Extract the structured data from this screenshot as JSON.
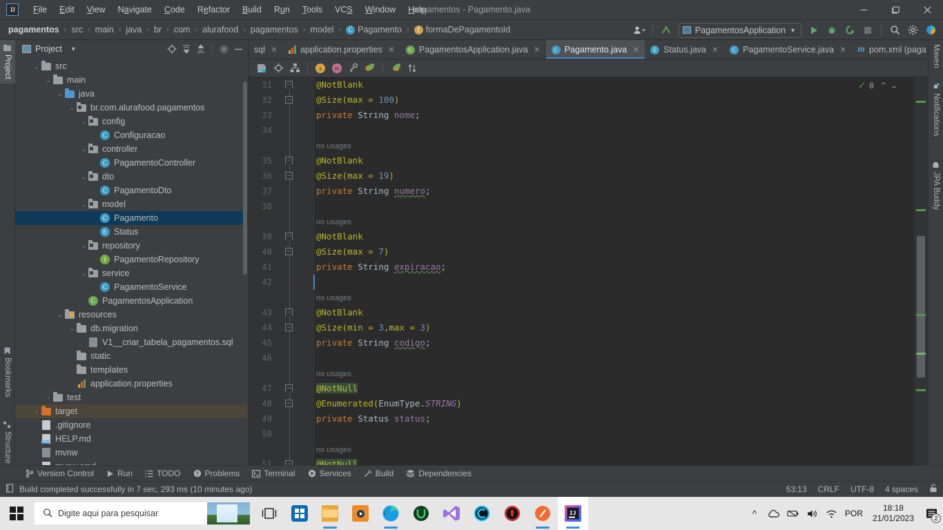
{
  "window": {
    "title": "pagamentos - Pagamento.java",
    "minimize": "—",
    "maximize": "❐",
    "close": "✕"
  },
  "menu": {
    "items": [
      {
        "label": "File"
      },
      {
        "label": "Edit"
      },
      {
        "label": "View"
      },
      {
        "label": "Navigate"
      },
      {
        "label": "Code"
      },
      {
        "label": "Refactor"
      },
      {
        "label": "Build"
      },
      {
        "label": "Run"
      },
      {
        "label": "Tools"
      },
      {
        "label": "VCS"
      },
      {
        "label": "Window"
      },
      {
        "label": "Help"
      }
    ]
  },
  "breadcrumbs": {
    "items": [
      {
        "label": "pagamentos",
        "icon": "none"
      },
      {
        "label": "src",
        "icon": "none"
      },
      {
        "label": "main",
        "icon": "none"
      },
      {
        "label": "java",
        "icon": "none"
      },
      {
        "label": "br",
        "icon": "none"
      },
      {
        "label": "com",
        "icon": "none"
      },
      {
        "label": "alurafood",
        "icon": "none"
      },
      {
        "label": "pagamentos",
        "icon": "none"
      },
      {
        "label": "model",
        "icon": "none"
      },
      {
        "label": "Pagamento",
        "icon": "class-badge"
      },
      {
        "label": "formaDePagamentoId",
        "icon": "field-badge"
      }
    ],
    "separator": "›"
  },
  "toolbar": {
    "account_icon": "user-account-icon",
    "update_icon": "vcs-update-icon",
    "run_config": "PagamentosApplication",
    "run_config_dropdown": "▾",
    "run_icon": "run-icon",
    "debug_icon": "debug-icon",
    "run_coverage_icon": "run-with-coverage-icon",
    "stop_icon": "stop-icon",
    "search_icon": "search-everywhere-icon",
    "settings_icon": "settings-gear-icon",
    "ai_icon": "ai-assistant-icon"
  },
  "left_strip": {
    "tabs": [
      {
        "label": "Project",
        "active": true,
        "icon": "project-folder-icon"
      },
      {
        "label": "Bookmarks",
        "active": false,
        "icon": "bookmark-icon"
      },
      {
        "label": "Structure",
        "active": false,
        "icon": "structure-icon"
      }
    ]
  },
  "right_strip": {
    "tabs": [
      {
        "label": "Maven",
        "icon": "maven-icon"
      },
      {
        "label": "Notifications",
        "icon": "notifications-bell-icon"
      },
      {
        "label": "JPA Buddy",
        "icon": "jpa-buddy-icon"
      }
    ]
  },
  "project_panel": {
    "title": "Project",
    "dropdown": "▾",
    "actions": [
      {
        "name": "select-opened-file",
        "glyph": "⊕"
      },
      {
        "name": "expand-all",
        "glyph": "⇟"
      },
      {
        "name": "collapse-all",
        "glyph": "⇞"
      },
      {
        "name": "settings",
        "glyph": "⚙"
      },
      {
        "name": "hide",
        "glyph": "—"
      }
    ],
    "tree": [
      {
        "label": "src",
        "indent": 1,
        "arrow": "down",
        "icon": "folder",
        "state": "normal"
      },
      {
        "label": "main",
        "indent": 2,
        "arrow": "down",
        "icon": "folder",
        "state": "normal"
      },
      {
        "label": "java",
        "indent": 3,
        "arrow": "down",
        "icon": "folder-blue",
        "state": "normal"
      },
      {
        "label": "br.com.alurafood.pagamentos",
        "indent": 4,
        "arrow": "down",
        "icon": "package",
        "state": "normal"
      },
      {
        "label": "config",
        "indent": 5,
        "arrow": "down",
        "icon": "package",
        "state": "normal"
      },
      {
        "label": "Configuracao",
        "indent": 6,
        "arrow": "none",
        "icon": "class",
        "state": "normal"
      },
      {
        "label": "controller",
        "indent": 5,
        "arrow": "down",
        "icon": "package",
        "state": "normal"
      },
      {
        "label": "PagamentoController",
        "indent": 6,
        "arrow": "none",
        "icon": "class",
        "state": "normal"
      },
      {
        "label": "dto",
        "indent": 5,
        "arrow": "down",
        "icon": "package",
        "state": "normal"
      },
      {
        "label": "PagamentoDto",
        "indent": 6,
        "arrow": "none",
        "icon": "class",
        "state": "normal"
      },
      {
        "label": "model",
        "indent": 5,
        "arrow": "down",
        "icon": "package",
        "state": "normal"
      },
      {
        "label": "Pagamento",
        "indent": 6,
        "arrow": "none",
        "icon": "class",
        "state": "selected"
      },
      {
        "label": "Status",
        "indent": 6,
        "arrow": "none",
        "icon": "enum",
        "state": "normal"
      },
      {
        "label": "repository",
        "indent": 5,
        "arrow": "down",
        "icon": "package",
        "state": "normal"
      },
      {
        "label": "PagamentoRepository",
        "indent": 6,
        "arrow": "none",
        "icon": "interface",
        "state": "normal"
      },
      {
        "label": "service",
        "indent": 5,
        "arrow": "down",
        "icon": "package",
        "state": "normal"
      },
      {
        "label": "PagamentoService",
        "indent": 6,
        "arrow": "none",
        "icon": "class",
        "state": "normal"
      },
      {
        "label": "PagamentosApplication",
        "indent": 5,
        "arrow": "none",
        "icon": "spring",
        "state": "normal"
      },
      {
        "label": "resources",
        "indent": 3,
        "arrow": "down",
        "icon": "folder-resources",
        "state": "normal"
      },
      {
        "label": "db.migration",
        "indent": 4,
        "arrow": "down",
        "icon": "folder",
        "state": "normal"
      },
      {
        "label": "V1__criar_tabela_pagamentos.sql",
        "indent": 5,
        "arrow": "none",
        "icon": "sql-file",
        "state": "normal"
      },
      {
        "label": "static",
        "indent": 4,
        "arrow": "none",
        "icon": "folder",
        "state": "normal"
      },
      {
        "label": "templates",
        "indent": 4,
        "arrow": "none",
        "icon": "folder",
        "state": "normal"
      },
      {
        "label": "application.properties",
        "indent": 4,
        "arrow": "none",
        "icon": "properties-file",
        "state": "normal"
      },
      {
        "label": "test",
        "indent": 2,
        "arrow": "right",
        "icon": "folder",
        "state": "normal"
      },
      {
        "label": "target",
        "indent": 1,
        "arrow": "right",
        "icon": "folder-orange",
        "state": "highlight"
      },
      {
        "label": ".gitignore",
        "indent": 1,
        "arrow": "none",
        "icon": "git-file",
        "state": "normal"
      },
      {
        "label": "HELP.md",
        "indent": 1,
        "arrow": "none",
        "icon": "md-file",
        "state": "normal"
      },
      {
        "label": "mvnw",
        "indent": 1,
        "arrow": "none",
        "icon": "exec-file",
        "state": "normal"
      },
      {
        "label": "mvnw.cmd",
        "indent": 1,
        "arrow": "none",
        "icon": "file",
        "state": "normal"
      }
    ]
  },
  "editor": {
    "tabs": [
      {
        "label": "sql",
        "icon": "sql-file-icon",
        "active": false,
        "truncated": true
      },
      {
        "label": "application.properties",
        "icon": "properties-file-icon",
        "active": false
      },
      {
        "label": "PagamentosApplication.java",
        "icon": "spring-class-icon",
        "active": false
      },
      {
        "label": "Pagamento.java",
        "icon": "class-icon",
        "active": true
      },
      {
        "label": "Status.java",
        "icon": "enum-icon",
        "active": false
      },
      {
        "label": "PagamentoService.java",
        "icon": "class-icon",
        "active": false
      },
      {
        "label": "pom.xml (paga",
        "icon": "maven-icon",
        "active": false
      }
    ],
    "tabs_overflow": "⌄",
    "tabs_options": "⋮",
    "toolbar_icons": [
      {
        "name": "ddl-icon"
      },
      {
        "name": "target-icon"
      },
      {
        "name": "diagram-icon"
      },
      {
        "name": "attribute-icon",
        "letter": "a"
      },
      {
        "name": "mapping-icon",
        "letter": "m"
      },
      {
        "name": "key-icon"
      },
      {
        "name": "search-leaf-icon"
      },
      {
        "name": "jpa-entity-icon"
      },
      {
        "name": "sort-icon"
      }
    ],
    "inspection": {
      "status_icon": "inspection-ok-icon",
      "count": "8",
      "prev": "⌃",
      "next": "⌄"
    },
    "lines": [
      {
        "num": "31",
        "fold": "down",
        "tokens": [
          {
            "t": "@NotBlank",
            "c": "ann"
          }
        ]
      },
      {
        "num": "32",
        "fold": "up",
        "tokens": [
          {
            "t": "@Size(",
            "c": "ann"
          },
          {
            "t": "max",
            "c": "ann"
          },
          {
            "t": " = ",
            "c": "ann"
          },
          {
            "t": "100",
            "c": "num"
          },
          {
            "t": ")",
            "c": "ann"
          }
        ]
      },
      {
        "num": "33",
        "fold": "line",
        "tokens": [
          {
            "t": "private",
            "c": "kw"
          },
          {
            "t": " ",
            "c": "plain"
          },
          {
            "t": "String",
            "c": "type"
          },
          {
            "t": " ",
            "c": "plain"
          },
          {
            "t": "nome",
            "c": "field"
          },
          {
            "t": ";",
            "c": "plain"
          }
        ]
      },
      {
        "num": "34",
        "fold": "line",
        "tokens": []
      },
      {
        "num": "",
        "fold": "line",
        "tokens": [
          {
            "t": "no usages",
            "c": "nousage"
          }
        ]
      },
      {
        "num": "35",
        "fold": "down",
        "tokens": [
          {
            "t": "@NotBlank",
            "c": "ann"
          }
        ]
      },
      {
        "num": "36",
        "fold": "up",
        "tokens": [
          {
            "t": "@Size(",
            "c": "ann"
          },
          {
            "t": "max",
            "c": "ann"
          },
          {
            "t": " = ",
            "c": "ann"
          },
          {
            "t": "19",
            "c": "num"
          },
          {
            "t": ")",
            "c": "ann"
          }
        ]
      },
      {
        "num": "37",
        "fold": "line",
        "tokens": [
          {
            "t": "private",
            "c": "kw"
          },
          {
            "t": " ",
            "c": "plain"
          },
          {
            "t": "String",
            "c": "type"
          },
          {
            "t": " ",
            "c": "plain"
          },
          {
            "t": "numero",
            "c": "field-squiggle"
          },
          {
            "t": ";",
            "c": "plain"
          }
        ]
      },
      {
        "num": "38",
        "fold": "line",
        "tokens": []
      },
      {
        "num": "",
        "fold": "line",
        "tokens": [
          {
            "t": "no usages",
            "c": "nousage"
          }
        ]
      },
      {
        "num": "39",
        "fold": "down",
        "tokens": [
          {
            "t": "@NotBlank",
            "c": "ann"
          }
        ]
      },
      {
        "num": "40",
        "fold": "up",
        "tokens": [
          {
            "t": "@Size(",
            "c": "ann"
          },
          {
            "t": "max",
            "c": "ann"
          },
          {
            "t": " = ",
            "c": "ann"
          },
          {
            "t": "7",
            "c": "num"
          },
          {
            "t": ")",
            "c": "ann"
          }
        ]
      },
      {
        "num": "41",
        "fold": "line",
        "tokens": [
          {
            "t": "private",
            "c": "kw"
          },
          {
            "t": " ",
            "c": "plain"
          },
          {
            "t": "String",
            "c": "type"
          },
          {
            "t": " ",
            "c": "plain"
          },
          {
            "t": "expiracao",
            "c": "field-squiggle"
          },
          {
            "t": ";",
            "c": "plain"
          }
        ]
      },
      {
        "num": "42",
        "fold": "line",
        "tokens": []
      },
      {
        "num": "",
        "fold": "line",
        "tokens": [
          {
            "t": "no usages",
            "c": "nousage"
          }
        ]
      },
      {
        "num": "43",
        "fold": "down",
        "tokens": [
          {
            "t": "@NotBlank",
            "c": "ann"
          }
        ]
      },
      {
        "num": "44",
        "fold": "up",
        "tokens": [
          {
            "t": "@Size(",
            "c": "ann"
          },
          {
            "t": "min",
            "c": "ann"
          },
          {
            "t": " = ",
            "c": "ann"
          },
          {
            "t": "3",
            "c": "num"
          },
          {
            "t": ",",
            "c": "ann"
          },
          {
            "t": "max",
            "c": "ann"
          },
          {
            "t": " = ",
            "c": "ann"
          },
          {
            "t": "3",
            "c": "num"
          },
          {
            "t": ")",
            "c": "ann"
          }
        ]
      },
      {
        "num": "45",
        "fold": "line",
        "tokens": [
          {
            "t": "private",
            "c": "kw"
          },
          {
            "t": " ",
            "c": "plain"
          },
          {
            "t": "String",
            "c": "type"
          },
          {
            "t": " ",
            "c": "plain"
          },
          {
            "t": "codigo",
            "c": "field-squiggle"
          },
          {
            "t": ";",
            "c": "plain"
          }
        ]
      },
      {
        "num": "46",
        "fold": "line",
        "tokens": []
      },
      {
        "num": "",
        "fold": "line",
        "tokens": [
          {
            "t": "no usages",
            "c": "nousage"
          }
        ]
      },
      {
        "num": "47",
        "fold": "down",
        "tokens": [
          {
            "t": "@NotNull",
            "c": "ann-hl"
          }
        ]
      },
      {
        "num": "48",
        "fold": "up",
        "tokens": [
          {
            "t": "@Enumerated(",
            "c": "ann"
          },
          {
            "t": "EnumType.",
            "c": "type"
          },
          {
            "t": "STRING",
            "c": "italic"
          },
          {
            "t": ")",
            "c": "ann"
          }
        ]
      },
      {
        "num": "49",
        "fold": "line",
        "tokens": [
          {
            "t": "private",
            "c": "kw"
          },
          {
            "t": " ",
            "c": "plain"
          },
          {
            "t": "Status",
            "c": "type"
          },
          {
            "t": " ",
            "c": "plain"
          },
          {
            "t": "status",
            "c": "field"
          },
          {
            "t": ";",
            "c": "plain"
          }
        ]
      },
      {
        "num": "50",
        "fold": "line",
        "tokens": []
      },
      {
        "num": "",
        "fold": "line",
        "tokens": [
          {
            "t": "no usages",
            "c": "nousage"
          }
        ]
      },
      {
        "num": "51",
        "fold": "down",
        "tokens": [
          {
            "t": "@NotNull",
            "c": "ann-hl"
          }
        ]
      }
    ]
  },
  "bottom_tool_bar": {
    "tabs": [
      {
        "label": "Version Control",
        "icon": "branch-icon"
      },
      {
        "label": "Run",
        "icon": "run-icon"
      },
      {
        "label": "TODO",
        "icon": "todo-list-icon"
      },
      {
        "label": "Problems",
        "icon": "problems-icon"
      },
      {
        "label": "Terminal",
        "icon": "terminal-icon"
      },
      {
        "label": "Services",
        "icon": "services-icon"
      },
      {
        "label": "Build",
        "icon": "build-hammer-icon"
      },
      {
        "label": "Dependencies",
        "icon": "dependencies-icon"
      }
    ]
  },
  "status_bar": {
    "icon": "build-status-icon",
    "message": "Build completed successfully in 7 sec, 293 ms (10 minutes ago)",
    "position": "53:13",
    "line_separator": "CRLF",
    "encoding": "UTF-8",
    "indent": "4 spaces",
    "lock_icon": "unlocked-icon"
  },
  "taskbar": {
    "start_icon": "windows-start-icon",
    "search_placeholder": "Digite aqui para pesquisar",
    "search_icon": "search-icon",
    "task_view_icon": "task-view-icon",
    "apps": [
      {
        "name": "microsoft-store-icon"
      },
      {
        "name": "file-explorer-icon"
      },
      {
        "name": "media-player-icon"
      },
      {
        "name": "microsoft-edge-icon"
      },
      {
        "name": "udemy-icon"
      },
      {
        "name": "visual-studio-icon"
      },
      {
        "name": "c-app-icon"
      },
      {
        "name": "red-app-icon"
      },
      {
        "name": "orange-app-icon"
      },
      {
        "name": "intellij-idea-icon"
      }
    ],
    "tray": {
      "expand_icon": "^",
      "onedrive_icon": "onedrive-icon",
      "battery_icon": "battery-icon",
      "volume_icon": "volume-icon",
      "wifi_icon": "wifi-icon",
      "language": "POR",
      "time": "18:18",
      "date": "21/01/2023",
      "notification_count": "2"
    }
  }
}
